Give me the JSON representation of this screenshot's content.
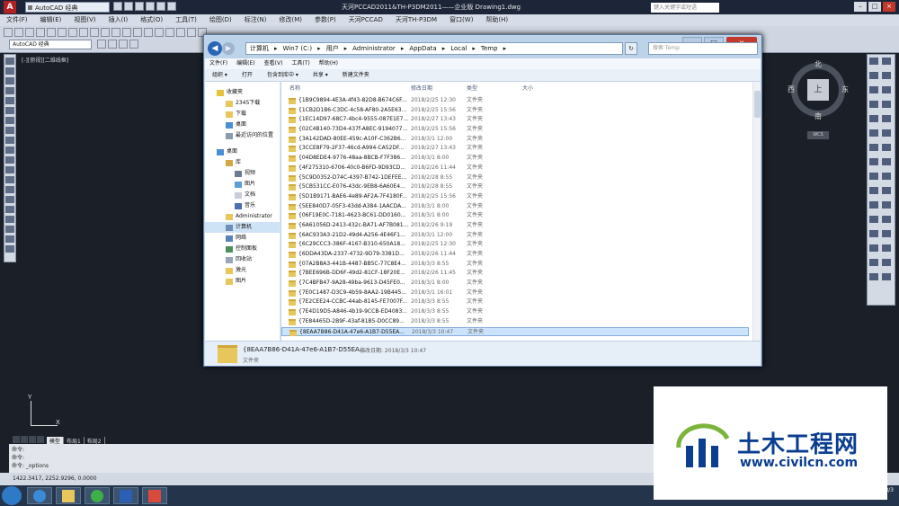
{
  "acad": {
    "workspace": "AutoCAD 经典",
    "caption": "天河PCCAD2011&TH-P3DM2011——企业版    Drawing1.dwg",
    "search_placeholder": "键入关键字或短语",
    "menu": [
      "文件(F)",
      "编辑(E)",
      "视图(V)",
      "插入(I)",
      "格式(O)",
      "工具(T)",
      "绘图(D)",
      "标注(N)",
      "修改(M)",
      "参数(P)",
      "天河PCCAD",
      "天河TH-P3DM",
      "窗口(W)",
      "帮助(H)"
    ],
    "toolbar_combo": "AutoCAD 经典",
    "viewport_label": "[-][俯视][二维线框]",
    "viewcube": {
      "north": "北",
      "south": "南",
      "west": "西",
      "east": "东",
      "face": "上",
      "wcs": "WCS"
    },
    "ucs": {
      "x": "X",
      "y": "Y"
    },
    "layout_tabs": [
      "模型",
      "布局1",
      "布局2"
    ],
    "command_lines": [
      "命令:",
      "命令:",
      "命令: _options"
    ],
    "coords": "1422.3417,  2252.9296,  0.0000",
    "clock": "2018/3/3"
  },
  "explorer": {
    "breadcrumb": [
      "计算机",
      "Win7 (C:)",
      "用户",
      "Administrator",
      "AppData",
      "Local",
      "Temp"
    ],
    "search_placeholder": "搜索 Temp",
    "menu": [
      "文件(F)",
      "编辑(E)",
      "查看(V)",
      "工具(T)",
      "帮助(H)"
    ],
    "commands": [
      "组织 ▾",
      "打开",
      "包含到库中 ▾",
      "共享 ▾",
      "新建文件夹"
    ],
    "nav": {
      "favorites": "收藏夹",
      "fav_items": [
        "2345下载",
        "下载",
        "桌面",
        "最近访问的位置"
      ],
      "desktop": "桌面",
      "library": "库",
      "lib_items": [
        "视频",
        "图片",
        "文档",
        "音乐"
      ],
      "admin": "Administrator",
      "computer": "计算机",
      "network": "网络",
      "control_panel": "控制面板",
      "recycle": "回收站",
      "extra1": "激光",
      "extra2": "图片"
    },
    "columns": {
      "name": "名称",
      "date": "修改日期",
      "type": "类型",
      "size": "大小"
    },
    "files": [
      {
        "name": "{1B9C9894-4E3A-4f43-82D8-B674C6F...",
        "date": "2018/2/25 12:30",
        "type": "文件夹"
      },
      {
        "name": "{1CB2D1B6-C3DC-4c58-AF80-2A5E63...",
        "date": "2018/2/25 15:56",
        "type": "文件夹"
      },
      {
        "name": "{1EC14D97-68C7-4bc4-9555-087E1E7...",
        "date": "2018/2/27 13:43",
        "type": "文件夹"
      },
      {
        "name": "{02C4B140-73D4-437f-A8EC-9194077...",
        "date": "2018/2/25 15:56",
        "type": "文件夹"
      },
      {
        "name": "{3A142DAD-80EE-459c-A10F-C362B6...",
        "date": "2018/3/1 12:00",
        "type": "文件夹"
      },
      {
        "name": "{3CCE8F79-2F37-46cd-A994-CA52DF...",
        "date": "2018/2/27 13:43",
        "type": "文件夹"
      },
      {
        "name": "{04D8EDE4-9776-48aa-8BCB-F7F386...",
        "date": "2018/3/1 8:00",
        "type": "文件夹"
      },
      {
        "name": "{4F275310-6706-40c0-B6FD-9D93CD...",
        "date": "2018/2/26 11:44",
        "type": "文件夹"
      },
      {
        "name": "{5C9D0352-D74C-4397-B742-1DEFEE...",
        "date": "2018/2/28 8:55",
        "type": "文件夹"
      },
      {
        "name": "{5CB531CC-E076-43dc-9EB8-6A60E4...",
        "date": "2018/2/28 8:55",
        "type": "文件夹"
      },
      {
        "name": "{5D1B9171-BAE6-4e89-AF2A-7F4180F...",
        "date": "2018/2/25 15:56",
        "type": "文件夹"
      },
      {
        "name": "{5EE840D7-05F3-43dd-A384-1AACDA...",
        "date": "2018/3/1 8:00",
        "type": "文件夹"
      },
      {
        "name": "{06F19E0C-7181-4623-BC61-DD0160...",
        "date": "2018/3/1 8:00",
        "type": "文件夹"
      },
      {
        "name": "{6A61056D-2413-432c-BA71-AF7B081...",
        "date": "2018/2/26 9:19",
        "type": "文件夹"
      },
      {
        "name": "{6AC933A3-21D2-49d4-A256-4E46F1...",
        "date": "2018/3/1 12:00",
        "type": "文件夹"
      },
      {
        "name": "{6C29CCC3-386F-4167-B310-650A18...",
        "date": "2018/2/25 12:30",
        "type": "文件夹"
      },
      {
        "name": "{6DDA43DA-2337-4732-9D79-3381D...",
        "date": "2018/2/26 11:44",
        "type": "文件夹"
      },
      {
        "name": "{07A2B8A3-441B-4487-BB5C-77C8E4...",
        "date": "2018/3/3 8:55",
        "type": "文件夹"
      },
      {
        "name": "{7BEE696B-DD6F-49d2-81CF-18F20E...",
        "date": "2018/2/26 11:45",
        "type": "文件夹"
      },
      {
        "name": "{7C4BFB47-9A28-49ba-9613-D45FE0...",
        "date": "2018/3/1 8:00",
        "type": "文件夹"
      },
      {
        "name": "{7E0C1487-D3C9-4b59-8AA2-19B445...",
        "date": "2018/3/1 16:01",
        "type": "文件夹"
      },
      {
        "name": "{7E2CEE24-CCBC-44ab-8145-FE7007F...",
        "date": "2018/3/3 8:55",
        "type": "文件夹"
      },
      {
        "name": "{7E4D19D5-A846-4b19-9CCB-ED4083...",
        "date": "2018/3/3 8:55",
        "type": "文件夹"
      },
      {
        "name": "{7E84465D-2B9F-43af-81B5-D0CC89...",
        "date": "2018/3/3 8:55",
        "type": "文件夹"
      },
      {
        "name": "{8EAA7B86-D41A-47e6-A1B7-D55EA...",
        "date": "2018/3/3 10:47",
        "type": "文件夹"
      }
    ],
    "details": {
      "name": "{8EAA7B86-D41A-47e6-A1B7-D55EA...",
      "modified_label": "修改日期: 2018/3/3 10:47",
      "type": "文件夹"
    }
  },
  "watermark": {
    "cn": "土木工程网",
    "url": "www.civilcn.com"
  },
  "colors": {
    "acad_bg": "#1b1f27",
    "explorer_frame": "#bcd3ea",
    "folder": "#e7c65b",
    "watermark_blue": "#0b3e91"
  }
}
